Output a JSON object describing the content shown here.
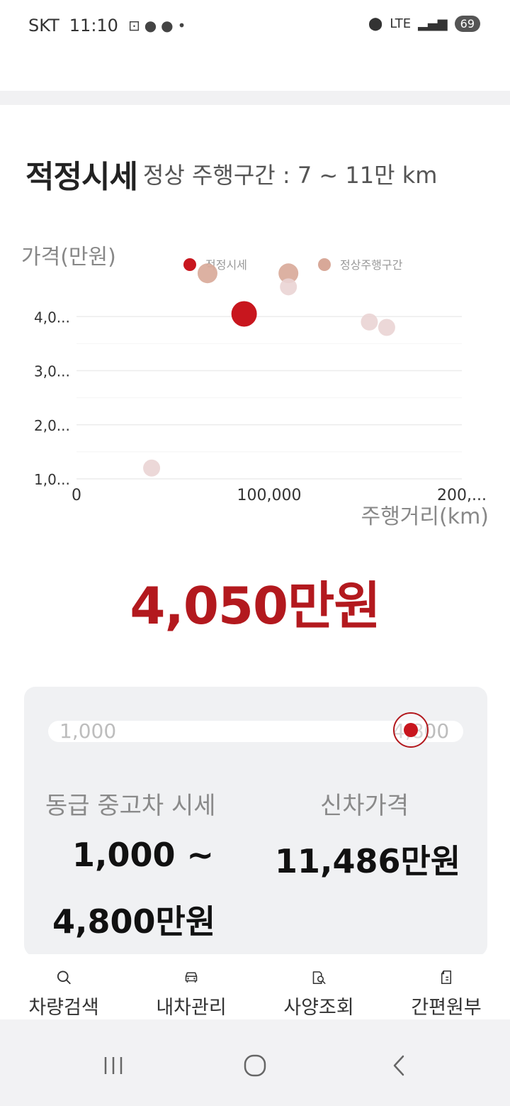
{
  "status": {
    "carrier": "SKT",
    "time": "11:10",
    "network": "LTE",
    "battery": "69"
  },
  "header": {
    "title": "적정시세",
    "normal_range": "정상 주행구간 : 7 ~ 11만 km"
  },
  "chart_data": {
    "type": "scatter",
    "ylabel": "가격(만원)",
    "xlabel": "주행거리(km)",
    "y_ticks": [
      "4,0...",
      "3,0...",
      "2,0...",
      "1,0..."
    ],
    "x_ticks": [
      "0",
      "100,000",
      "200,..."
    ],
    "legend": [
      {
        "name": "적정시세",
        "color": "#c8161e"
      },
      {
        "name": "정상주행구간",
        "color": "#d8a898"
      }
    ],
    "xlim": [
      0,
      200000
    ],
    "ylim": [
      1000,
      5000
    ],
    "series": [
      {
        "name": "적정시세",
        "points": [
          {
            "x": 87000,
            "y": 4050
          }
        ]
      },
      {
        "name": "정상주행구간",
        "points": [
          {
            "x": 68000,
            "y": 4800
          },
          {
            "x": 110000,
            "y": 4800
          }
        ]
      },
      {
        "name": "",
        "points": [
          {
            "x": 110000,
            "y": 4550
          },
          {
            "x": 152000,
            "y": 3900
          },
          {
            "x": 161000,
            "y": 3800
          },
          {
            "x": 39000,
            "y": 1200
          }
        ]
      }
    ]
  },
  "price": "4,050만원",
  "range_card": {
    "slider_min": "1,000",
    "slider_max": "4,800",
    "slider_value": 4050,
    "used_label": "동급 중고차 시세",
    "used_value_line1": "1,000 ~",
    "used_value_line2": "4,800만원",
    "new_label": "신차가격",
    "new_value": "11,486만원"
  },
  "nav": {
    "items": [
      {
        "label": "차량검색",
        "icon": "search-icon"
      },
      {
        "label": "내차관리",
        "icon": "car-icon"
      },
      {
        "label": "사양조회",
        "icon": "spec-search-icon"
      },
      {
        "label": "간편원부",
        "icon": "document-icon"
      }
    ]
  },
  "colors": {
    "accent": "#b3191e",
    "point_main": "#c8161e",
    "point_normal": "#d8a898",
    "point_other": "#ead4d4",
    "card_bg": "#f0f1f3"
  }
}
